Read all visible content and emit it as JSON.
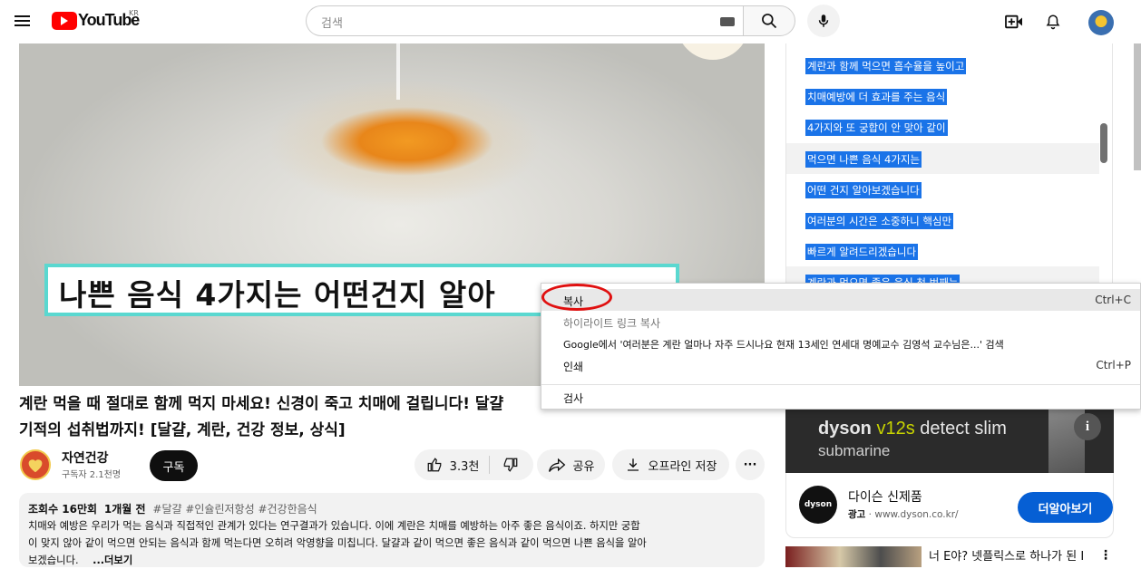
{
  "header": {
    "logo_text": "YouTube",
    "region": "KR",
    "search_placeholder": "검색"
  },
  "video": {
    "caption_text": "나쁜 음식 4가지는 어떤건지 알아",
    "title_line1": "계란 먹을 때 절대로 함께 먹지 마세요! 신경이 죽고 치매에 걸립니다! 달걀",
    "title_line2": "기적의 섭취법까지! [달걀, 계란, 건강 정보, 상식]"
  },
  "channel": {
    "name": "자연건강",
    "subscribers": "구독자 2.1천명",
    "subscribe_label": "구독"
  },
  "actions": {
    "like_count": "3.3천",
    "share_label": "공유",
    "download_label": "오프라인 저장",
    "more_label": "···"
  },
  "description": {
    "views": "조회수 16만회",
    "age": "1개월 전",
    "tags": "#달걀 #인슐린저항성 #건강한음식",
    "line1": "치매와 예방은 우리가 먹는 음식과 직접적인 관계가 있다는 연구결과가 있습니다. 이에 계란은 치매를 예방하는 아주 좋은 음식이죠. 하지만 궁합",
    "line2": "이 맞지 않아 같이 먹으면 안되는 음식과 함께 먹는다면 오히려 악영향을 미칩니다. 달걀과 같이 먹으면 좋은 음식과 같이 먹으면 나쁜 음식을 알아",
    "line3": "보겠습니다.",
    "more": "...더보기"
  },
  "transcript": {
    "lines": [
      "계란과 함께 먹으면 흡수율을 높이고",
      "치매예방에 더 효과를 주는 음식",
      "4가지와 또 궁합이 안 맞아 같이",
      "먹으면 나쁜 음식 4가지는",
      "어떤 건지 알아보겠습니다",
      "여러분의 시간은 소중하니 핵심만",
      "빠르게 알려드리겠습니다",
      "계란과 먹으면 좋은 음식 첫 번째는"
    ]
  },
  "context_menu": {
    "copy": "복사",
    "copy_shortcut": "Ctrl+C",
    "highlight_link": "하이라이트 링크 복사",
    "google_search": "Google에서 '여러분은 계란 얼마나 자주 드시나요 현재 13세인 연세대 명예교수 김영석 교수님은...' 검색",
    "print": "인쇄",
    "print_shortcut": "Ctrl+P",
    "inspect": "검사"
  },
  "ad": {
    "banner_brand": "dyson",
    "banner_model": "v12s",
    "banner_text": "detect slim",
    "banner_sub": "submarine",
    "logo_text": "dyson",
    "title": "다이슨 신제품",
    "ad_label": "광고",
    "domain": "www.dyson.co.kr/",
    "cta": "더알아보기"
  },
  "next_video": {
    "title": "너 E야? 넷플릭스로 하나가 된 I"
  },
  "colors": {
    "accent_red": "#ff0000",
    "selection_blue": "#1a73e8",
    "cta_blue": "#065fd4",
    "annotation_red": "#e01010"
  }
}
